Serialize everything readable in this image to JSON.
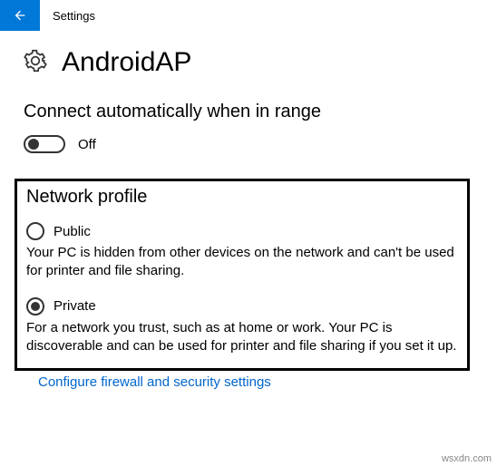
{
  "titlebar": {
    "title": "Settings",
    "back_icon": "back-arrow"
  },
  "network": {
    "icon": "gear-icon",
    "name": "AndroidAP"
  },
  "auto_connect": {
    "heading": "Connect automatically when in range",
    "toggle_state": "Off"
  },
  "profile": {
    "heading": "Network profile",
    "options": [
      {
        "label": "Public",
        "description": "Your PC is hidden from other devices on the network and can't be used for printer and file sharing.",
        "selected": false
      },
      {
        "label": "Private",
        "description": "For a network you trust, such as at home or work. Your PC is discoverable and can be used for printer and file sharing if you set it up.",
        "selected": true
      }
    ]
  },
  "link": {
    "label": "Configure firewall and security settings"
  },
  "watermark": "wsxdn.com"
}
